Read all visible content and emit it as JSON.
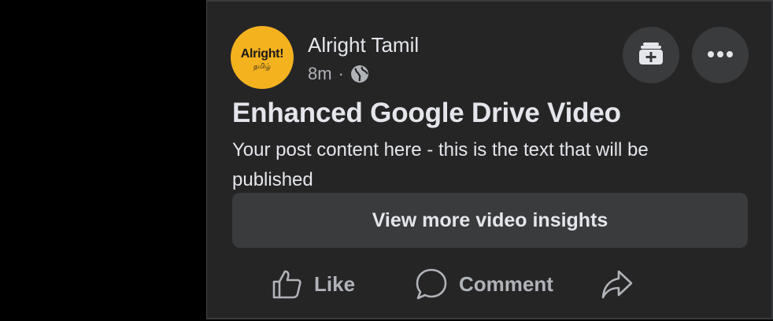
{
  "post": {
    "page_name": "Alright Tamil",
    "timestamp": "8m",
    "separator": "·",
    "audience_icon": "globe-icon",
    "avatar": {
      "main": "Alright!",
      "sub": "தமிழ்"
    },
    "title": "Enhanced Google Drive Video",
    "content": "Your post content here - this is the text that will be\npublished",
    "insights_label": "View more video insights"
  },
  "actions": {
    "like_label": "Like",
    "comment_label": "Comment",
    "share_label": ""
  },
  "icons": {
    "save": "save-to-collection-icon",
    "more": "more-options-icon",
    "like": "thumbs-up-icon",
    "comment": "comment-bubble-icon",
    "share": "share-arrow-icon"
  },
  "colors": {
    "card_background": "#252526",
    "button_background": "#3a3b3c",
    "primary_text": "#e4e6eb",
    "secondary_text": "#b0b3b8",
    "avatar_background": "#f5b21f"
  }
}
